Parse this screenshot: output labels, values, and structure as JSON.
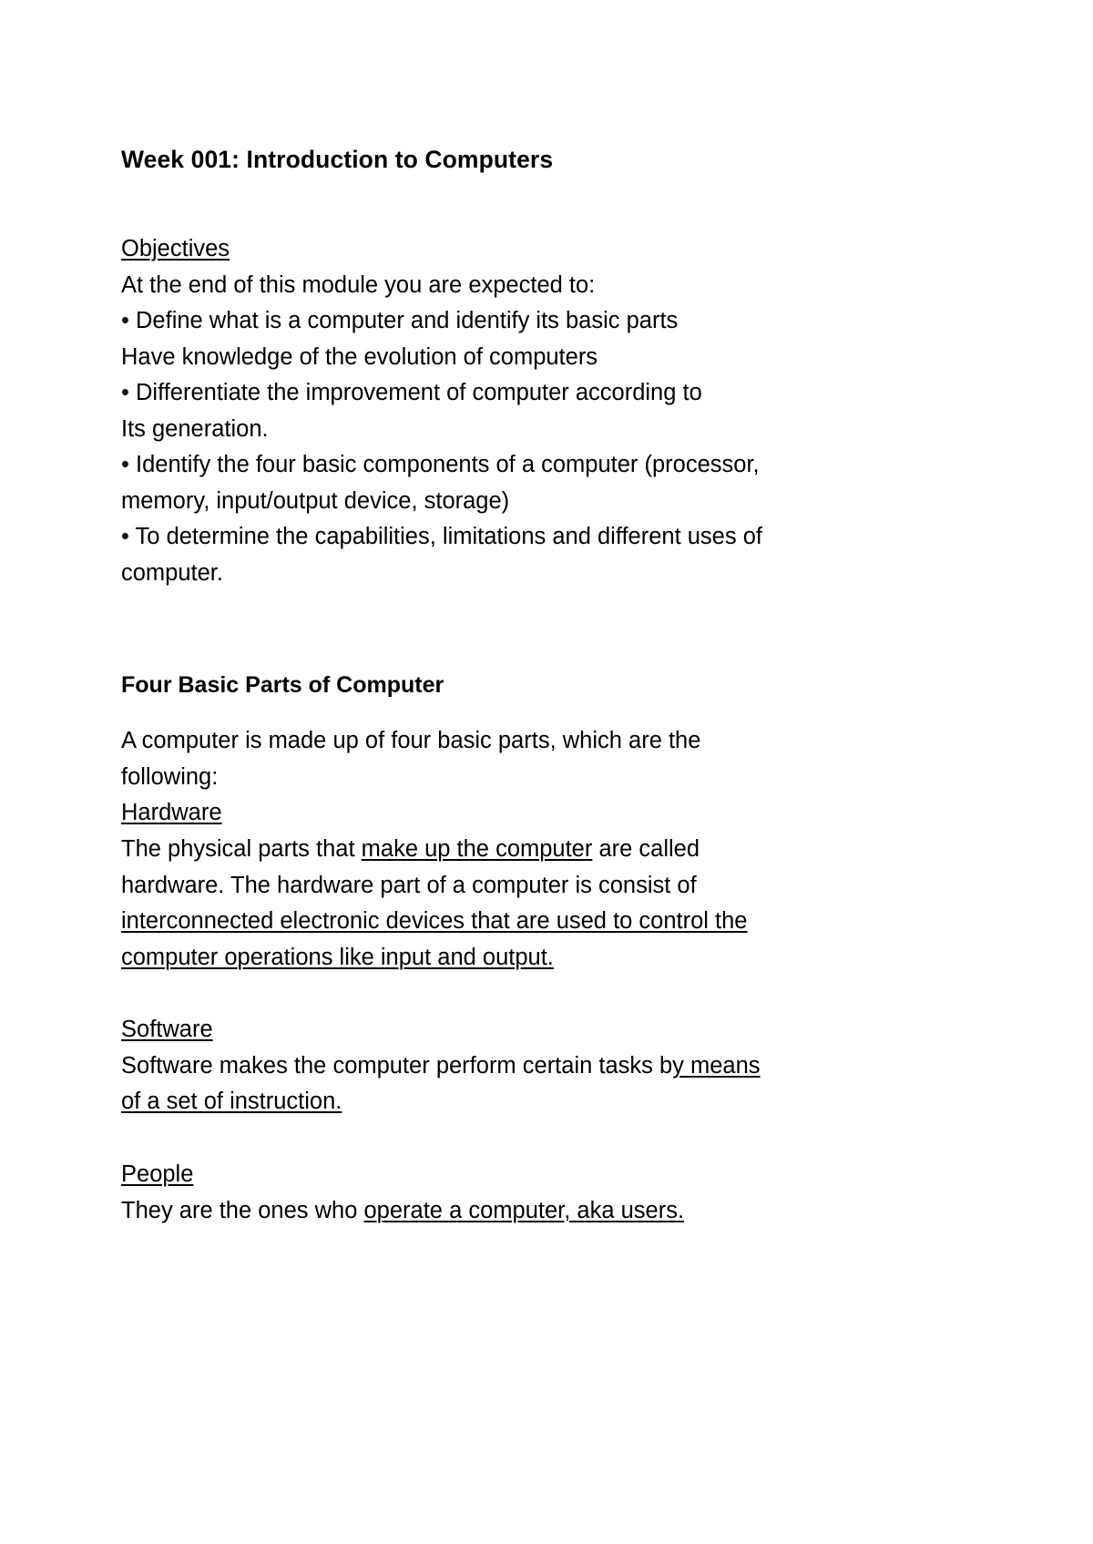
{
  "document": {
    "title": "Week 001: Introduction to Computers",
    "objectives": {
      "heading": "Objectives",
      "intro": "At the end of this module you are expected to:",
      "lines": [
        "• Define what is a computer and identify its basic parts",
        "Have knowledge of the evolution of computers",
        "• Differentiate the improvement of computer according to",
        "Its generation.",
        "• Identify the four basic components of a computer (processor,",
        "memory, input/output device, storage)",
        "• To determine the capabilities, limitations and different uses of",
        "computer."
      ]
    },
    "four_basic_parts": {
      "heading": "Four Basic Parts of Computer",
      "intro_line_1": "A computer is made up of four basic parts, which are the",
      "intro_line_2": "following:",
      "parts": [
        {
          "heading": "Hardware",
          "line_1_plain_a": "The physical parts that ",
          "line_1_underlined": "make up the computer",
          "line_1_plain_b": " are called",
          "line_2": "hardware. The hardware part of a computer is consist of",
          "line_3_underlined": "interconnected electronic devices that are used to control the",
          "line_4_underlined": "computer operations like input and output."
        },
        {
          "heading": "Software",
          "line_1_plain_a": "Software makes the computer perform certain tasks b",
          "line_1_underlined": "y means",
          "line_2_underlined": "of a set of instruction."
        },
        {
          "heading": "People",
          "line_1_plain_a": "They are the ones who ",
          "line_1_underlined": "operate a computer, aka users."
        }
      ]
    }
  }
}
